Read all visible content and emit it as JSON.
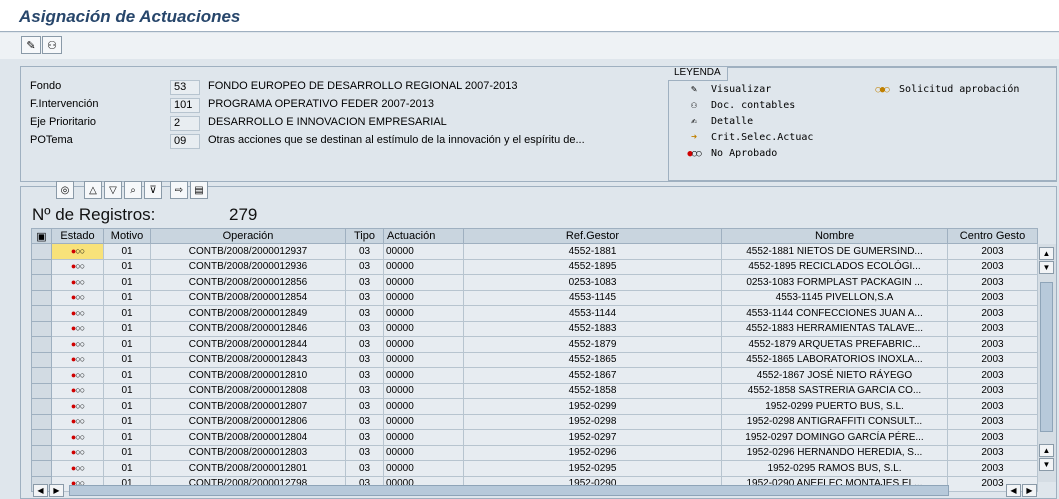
{
  "title": "Asignación de Actuaciones",
  "fields": [
    {
      "label": "Fondo",
      "code": "53",
      "desc": "FONDO EUROPEO DE DESARROLLO REGIONAL 2007-2013"
    },
    {
      "label": "F.Intervención",
      "code": "101",
      "desc": "PROGRAMA OPERATIVO FEDER 2007-2013"
    },
    {
      "label": "Eje Prioritario",
      "code": "2",
      "desc": "DESARROLLO E INNOVACION EMPRESARIAL"
    },
    {
      "label": "POTema",
      "code": "09",
      "desc": "Otras acciones que se destinan al estímulo de la innovación y el espíritu de..."
    }
  ],
  "legend": {
    "title": "LEYENDA",
    "items": [
      {
        "icon": "pencil-icon",
        "label": "Visualizar"
      },
      {
        "icon": "glasses-icon",
        "label": "Doc. contables"
      },
      {
        "icon": "edit-detail-icon",
        "label": "Detalle"
      },
      {
        "icon": "arrow-right-icon",
        "label": "Crit.Selec.Actuac"
      },
      {
        "icon": "status-red-icon",
        "label": "No Aprobado"
      },
      {
        "icon": "status-yellow-icon",
        "label": "Solicitud aprobación"
      }
    ]
  },
  "records_label": "Nº de Registros:",
  "records_count": "279",
  "columns": [
    "Estado",
    "Motivo",
    "Operación",
    "Tipo",
    "Actuación",
    "Ref.Gestor",
    "Nombre",
    "Centro Gesto"
  ],
  "rows": [
    {
      "motivo": "01",
      "operacion": "CONTB/2008/2000012937",
      "tipo": "03",
      "actuacion": "00000",
      "ref": "4552-1881",
      "nombre": "4552-1881 NIETOS DE GUMERSIND...",
      "centro": "2003"
    },
    {
      "motivo": "01",
      "operacion": "CONTB/2008/2000012936",
      "tipo": "03",
      "actuacion": "00000",
      "ref": "4552-1895",
      "nombre": "4552-1895 RECICLADOS ECOLÓGI...",
      "centro": "2003"
    },
    {
      "motivo": "01",
      "operacion": "CONTB/2008/2000012856",
      "tipo": "03",
      "actuacion": "00000",
      "ref": "0253-1083",
      "nombre": "0253-1083 FORMPLAST PACKAGIN ...",
      "centro": "2003"
    },
    {
      "motivo": "01",
      "operacion": "CONTB/2008/2000012854",
      "tipo": "03",
      "actuacion": "00000",
      "ref": "4553-1145",
      "nombre": "4553-1145 PIVELLON,S.A",
      "centro": "2003"
    },
    {
      "motivo": "01",
      "operacion": "CONTB/2008/2000012849",
      "tipo": "03",
      "actuacion": "00000",
      "ref": "4553-1144",
      "nombre": "4553-1144 CONFECCIONES JUAN A...",
      "centro": "2003"
    },
    {
      "motivo": "01",
      "operacion": "CONTB/2008/2000012846",
      "tipo": "03",
      "actuacion": "00000",
      "ref": "4552-1883",
      "nombre": "4552-1883 HERRAMIENTAS TALAVE...",
      "centro": "2003"
    },
    {
      "motivo": "01",
      "operacion": "CONTB/2008/2000012844",
      "tipo": "03",
      "actuacion": "00000",
      "ref": "4552-1879",
      "nombre": "4552-1879 ARQUETAS PREFABRIC...",
      "centro": "2003"
    },
    {
      "motivo": "01",
      "operacion": "CONTB/2008/2000012843",
      "tipo": "03",
      "actuacion": "00000",
      "ref": "4552-1865",
      "nombre": "4552-1865 LABORATORIOS INOXLA...",
      "centro": "2003"
    },
    {
      "motivo": "01",
      "operacion": "CONTB/2008/2000012810",
      "tipo": "03",
      "actuacion": "00000",
      "ref": "4552-1867",
      "nombre": "4552-1867 JOSÉ NIETO RÁYEGO",
      "centro": "2003"
    },
    {
      "motivo": "01",
      "operacion": "CONTB/2008/2000012808",
      "tipo": "03",
      "actuacion": "00000",
      "ref": "4552-1858",
      "nombre": "4552-1858 SASTRERIA GARCIA CO...",
      "centro": "2003"
    },
    {
      "motivo": "01",
      "operacion": "CONTB/2008/2000012807",
      "tipo": "03",
      "actuacion": "00000",
      "ref": "1952-0299",
      "nombre": "1952-0299 PUERTO BUS, S.L.",
      "centro": "2003"
    },
    {
      "motivo": "01",
      "operacion": "CONTB/2008/2000012806",
      "tipo": "03",
      "actuacion": "00000",
      "ref": "1952-0298",
      "nombre": "1952-0298 ANTIGRAFFITI CONSULT...",
      "centro": "2003"
    },
    {
      "motivo": "01",
      "operacion": "CONTB/2008/2000012804",
      "tipo": "03",
      "actuacion": "00000",
      "ref": "1952-0297",
      "nombre": "1952-0297 DOMINGO GARCÍA PÉRE...",
      "centro": "2003"
    },
    {
      "motivo": "01",
      "operacion": "CONTB/2008/2000012803",
      "tipo": "03",
      "actuacion": "00000",
      "ref": "1952-0296",
      "nombre": "1952-0296 HERNANDO HEREDIA, S...",
      "centro": "2003"
    },
    {
      "motivo": "01",
      "operacion": "CONTB/2008/2000012801",
      "tipo": "03",
      "actuacion": "00000",
      "ref": "1952-0295",
      "nombre": "1952-0295 RAMOS BUS, S.L.",
      "centro": "2003"
    },
    {
      "motivo": "01",
      "operacion": "CONTB/2008/2000012798",
      "tipo": "03",
      "actuacion": "00000",
      "ref": "1952-0290",
      "nombre": "1952-0290 ANEFLEC MONTAJES EL...",
      "centro": "2003"
    }
  ]
}
